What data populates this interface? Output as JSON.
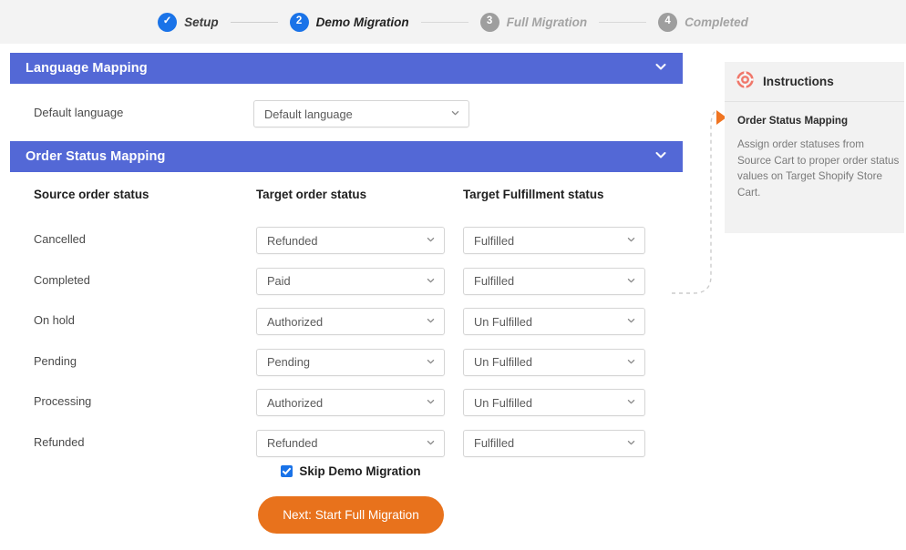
{
  "stepper": {
    "steps": [
      {
        "marker": "✓",
        "label": "Setup",
        "state": "done"
      },
      {
        "marker": "2",
        "label": "Demo Migration",
        "state": "current"
      },
      {
        "marker": "3",
        "label": "Full Migration",
        "state": "todo"
      },
      {
        "marker": "4",
        "label": "Completed",
        "state": "todo"
      }
    ]
  },
  "language_panel": {
    "title": "Language Mapping",
    "chevron_icon": "chevron-down-icon",
    "field_label": "Default language",
    "select_value": "Default language"
  },
  "order_panel": {
    "title": "Order Status Mapping",
    "chevron_icon": "chevron-down-icon",
    "columns": [
      "Source order status",
      "Target order status",
      "Target Fulfillment status"
    ],
    "rows": [
      {
        "source": "Cancelled",
        "target_order": "Refunded",
        "target_fulfillment": "Fulfilled"
      },
      {
        "source": "Completed",
        "target_order": "Paid",
        "target_fulfillment": "Fulfilled"
      },
      {
        "source": "On hold",
        "target_order": "Authorized",
        "target_fulfillment": "Un Fulfilled"
      },
      {
        "source": "Pending",
        "target_order": "Pending",
        "target_fulfillment": "Un Fulfilled"
      },
      {
        "source": "Processing",
        "target_order": "Authorized",
        "target_fulfillment": "Un Fulfilled"
      },
      {
        "source": "Refunded",
        "target_order": "Refunded",
        "target_fulfillment": "Fulfilled"
      }
    ]
  },
  "skip": {
    "label": "Skip Demo Migration",
    "checked": true
  },
  "cta": {
    "label": "Next: Start Full Migration"
  },
  "instructions": {
    "icon": "lifebuoy-icon",
    "title": "Instructions",
    "section": "Order Status Mapping",
    "body": "Assign order statuses from Source Cart to proper order status values on Target Shopify Store Cart."
  },
  "colors": {
    "panel_header": "#5368d6",
    "step_active": "#1a73e8",
    "step_inactive": "#9e9e9e",
    "cta": "#e8721c",
    "arrow": "#f07522",
    "instructions_bg": "#f2f2f2",
    "stepper_bg": "#f3f3f3"
  }
}
